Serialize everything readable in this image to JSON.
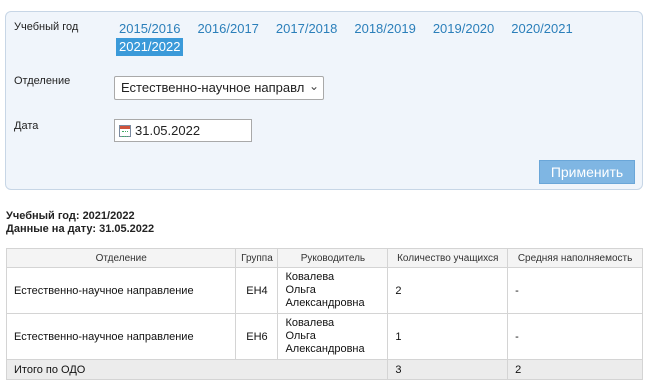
{
  "filters": {
    "year_label": "Учебный год",
    "years": [
      "2015/2016",
      "2016/2017",
      "2017/2018",
      "2018/2019",
      "2019/2020",
      "2020/2021",
      "2021/2022"
    ],
    "active_year_index": 6,
    "department_label": "Отделение",
    "department_value": "Естественно-научное направл",
    "date_label": "Дата",
    "date_value": "31.05.2022",
    "apply_label": "Применить"
  },
  "summary": {
    "year_line": "Учебный год: 2021/2022",
    "date_line": "Данные на дату: 31.05.2022"
  },
  "table": {
    "headers": [
      "Отделение",
      "Группа",
      "Руководитель",
      "Количество учащихся",
      "Средняя наполняемость"
    ],
    "rows": [
      {
        "department": "Естественно-научное направление",
        "group": "ЕН4",
        "leader": [
          "Ковалева",
          "Ольга",
          "Александровна"
        ],
        "students": "2",
        "avg_fill": "-"
      },
      {
        "department": "Естественно-научное направление",
        "group": "ЕН6",
        "leader": [
          "Ковалева",
          "Ольга",
          "Александровна"
        ],
        "students": "1",
        "avg_fill": "-"
      }
    ],
    "total": {
      "label": "Итого по ОДО",
      "students": "3",
      "avg_fill": "2"
    }
  },
  "colors": {
    "accent": "#3b9ad9",
    "link": "#2b7fba",
    "button": "#7fb6e3",
    "panel": "#f0f5fb"
  },
  "icons": {
    "date_picker": "calendar-icon",
    "select_toggle": "chevron-down-icon"
  }
}
